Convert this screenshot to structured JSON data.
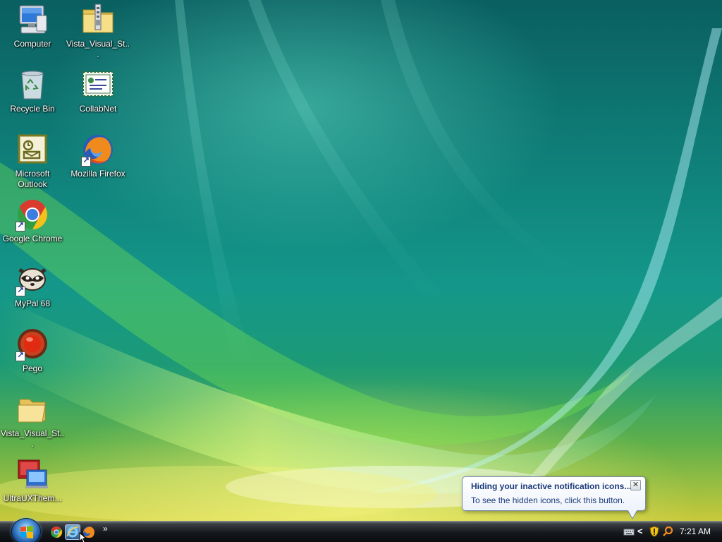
{
  "desktop": {
    "icons": [
      {
        "label": "Computer"
      },
      {
        "label": "Vista_Visual_St..."
      },
      {
        "label": "Recycle Bin"
      },
      {
        "label": "CollabNet"
      },
      {
        "label": "Microsoft Outlook"
      },
      {
        "label": "Mozilla Firefox"
      },
      {
        "label": "Google Chrome"
      },
      {
        "label": "MyPal 68"
      },
      {
        "label": "Pego"
      },
      {
        "label": "Vista_Visual_St..."
      },
      {
        "label": "UltraUXThem..."
      }
    ]
  },
  "balloon": {
    "title": "Hiding your inactive notification icons...",
    "text": "To see the hidden icons, click this button.",
    "close_label": "✕"
  },
  "taskbar": {
    "quicklaunch_overflow": "»",
    "tray_expand": "<",
    "clock": "7:21 AM"
  },
  "icons": {
    "start": "windows-flag-icon",
    "ql1": "chrome-icon",
    "ql2": "internet-explorer-icon",
    "ql3": "firefox-icon",
    "tray1": "keyboard-icon",
    "tray2": "security-shield-icon",
    "tray3": "search-icon"
  },
  "colors": {
    "taskbar": "#15181c",
    "balloon_text": "#1b3a7a",
    "icon_label": "#ffffff"
  }
}
